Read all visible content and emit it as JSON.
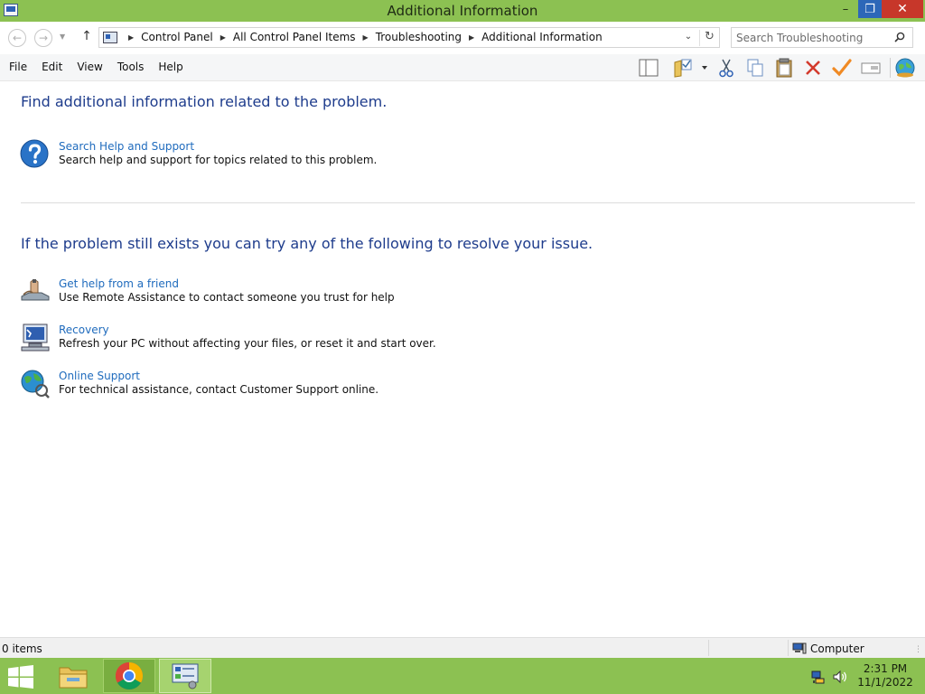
{
  "window": {
    "title": "Additional Information",
    "minimize_glyph": "–",
    "maximize_glyph": "❐",
    "close_glyph": "✕"
  },
  "address": {
    "breadcrumbs": [
      "Control Panel",
      "All Control Panel Items",
      "Troubleshooting",
      "Additional Information"
    ],
    "search_placeholder": "Search Troubleshooting"
  },
  "menu": [
    "File",
    "Edit",
    "View",
    "Tools",
    "Help"
  ],
  "toolbar_icons": [
    "layout-pane-icon",
    "properties-folder-icon",
    "cut-icon",
    "copy-icon",
    "paste-icon",
    "delete-icon",
    "checkmark-icon",
    "rename-icon",
    "globe-icon"
  ],
  "section1": {
    "heading": "Find additional information related to the problem.",
    "items": [
      {
        "icon": "help-icon",
        "link": "Search Help and Support",
        "desc": "Search help and support for topics related to this problem."
      }
    ]
  },
  "section2": {
    "heading": "If the problem still exists you can try any of the following to resolve your issue.",
    "items": [
      {
        "icon": "remote-assistance-icon",
        "link": "Get help from a friend",
        "desc": "Use Remote Assistance to contact someone you trust for help"
      },
      {
        "icon": "recovery-icon",
        "link": "Recovery",
        "desc": "Refresh your PC without affecting your files, or reset it and start over."
      },
      {
        "icon": "online-support-icon",
        "link": "Online Support",
        "desc": "For technical assistance, contact Customer Support online."
      }
    ]
  },
  "status": {
    "items_count": "0 items",
    "location": "Computer"
  },
  "taskbar": {
    "apps": [
      "file-explorer-icon",
      "chrome-icon",
      "control-panel-icon"
    ],
    "time": "2:31 PM",
    "date": "11/1/2022"
  },
  "colors": {
    "accent_green": "#8cc152",
    "heading_blue": "#1e3c8c",
    "link_blue": "#1f6bbd",
    "close_red": "#c7372a"
  }
}
